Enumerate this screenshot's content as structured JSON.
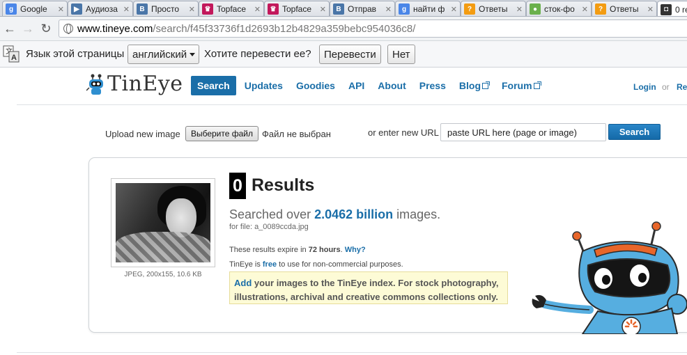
{
  "tabs": [
    {
      "label": "Google",
      "icon": "google-icon",
      "color": "#4a86e8",
      "active": false
    },
    {
      "label": "Аудиоза",
      "icon": "play-icon",
      "color": "#4a76a8",
      "active": false
    },
    {
      "label": "Просто",
      "icon": "vk-icon",
      "color": "#4a76a8",
      "active": false
    },
    {
      "label": "Topface",
      "icon": "crown-icon",
      "color": "#c2185b",
      "active": false
    },
    {
      "label": "Topface",
      "icon": "crown-icon",
      "color": "#c2185b",
      "active": false
    },
    {
      "label": "Отправ",
      "icon": "vk-icon",
      "color": "#4a76a8",
      "active": false
    },
    {
      "label": "найти ф",
      "icon": "google-icon",
      "color": "#4a86e8",
      "active": false
    },
    {
      "label": "Ответы",
      "icon": "answers-icon",
      "color": "#f39c12",
      "active": false
    },
    {
      "label": "сток-фо",
      "icon": "circle-icon",
      "color": "#6ab04c",
      "active": false
    },
    {
      "label": "Ответы",
      "icon": "answers-icon",
      "color": "#f39c12",
      "active": false
    },
    {
      "label": "0 re",
      "icon": "tineye-icon",
      "color": "#333333",
      "active": true
    }
  ],
  "address": {
    "host": "www.tineye.com",
    "path": "/search/f45f33736f1d2693b12b4829a359bebc954036c8/"
  },
  "translate_bar": {
    "page_language_label": "Язык этой страницы",
    "language": "английский",
    "question": "Хотите перевести ее?",
    "translate_button": "Перевести",
    "no_button": "Нет"
  },
  "header": {
    "logo_text": "TinEye",
    "nav": [
      {
        "label": "Search",
        "active": true,
        "external": false
      },
      {
        "label": "Updates",
        "active": false,
        "external": false
      },
      {
        "label": "Goodies",
        "active": false,
        "external": false
      },
      {
        "label": "API",
        "active": false,
        "external": false
      },
      {
        "label": "About",
        "active": false,
        "external": false
      },
      {
        "label": "Press",
        "active": false,
        "external": false
      },
      {
        "label": "Blog",
        "active": false,
        "external": true
      },
      {
        "label": "Forum",
        "active": false,
        "external": true
      }
    ],
    "login": "Login",
    "or": "or",
    "register": "Re"
  },
  "upload": {
    "label": "Upload new image",
    "file_button": "Выберите файл",
    "file_status": "Файл не выбран",
    "url_label": "or enter new URL",
    "url_placeholder": "paste URL here (page or image)",
    "search_button": "Search"
  },
  "results": {
    "count": "0",
    "results_word": "Results",
    "searched_prefix": "Searched over",
    "searched_number": "2.0462 billion",
    "searched_suffix": "images.",
    "for_file": "for file: a_0089ccda.jpg",
    "image_caption": "JPEG, 200x155, 10.6 KB",
    "expire_prefix": "These results expire in",
    "expire_time": "72 hours",
    "expire_dot": ".",
    "why_link": "Why?",
    "free_prefix": "TinEye is",
    "free_link": "free",
    "free_suffix": "to use for non-commercial purposes.",
    "promo_link": "Add",
    "promo_text_1": "your images to the TinEye index. For stock photography,",
    "promo_text_2": "illustrations, archival and creative commons collections only."
  },
  "colors": {
    "brand_blue": "#1a6ea8",
    "promo_bg": "#fdfbd6"
  }
}
